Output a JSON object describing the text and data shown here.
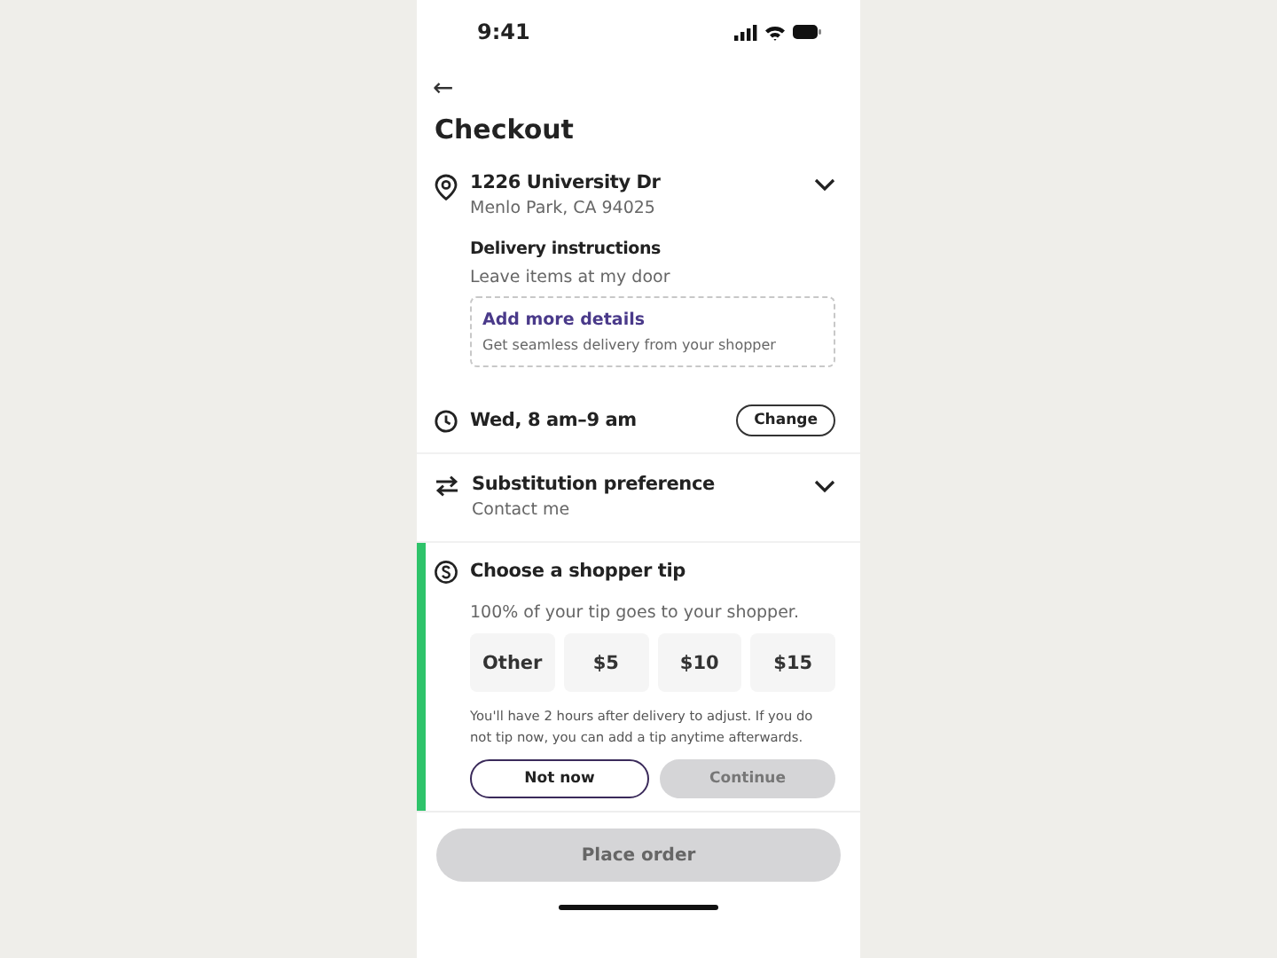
{
  "status_bar": {
    "time": "9:41"
  },
  "header": {
    "back": "←",
    "title": "Checkout"
  },
  "address": {
    "line1": "1226 University Dr",
    "line2": "Menlo Park, CA 94025",
    "expanded": false,
    "instructions_label": "Delivery instructions",
    "instructions": "Leave items at my door",
    "details_link": "Add more details",
    "details_hint": "Get seamless delivery from your shopper"
  },
  "delivery_time": {
    "label": "Wed, 8 am–9 am",
    "button": "Change"
  },
  "substitution": {
    "title": "Substitution preference",
    "value": "Contact me",
    "expanded": false
  },
  "tip": {
    "title": "Choose a shopper tip",
    "subtitle": "100% of your tip goes to your shopper.",
    "options": [
      {
        "label": "Other",
        "selected": false
      },
      {
        "label": "$5",
        "selected": false
      },
      {
        "label": "$10",
        "selected": false
      },
      {
        "label": "$15",
        "selected": false
      }
    ],
    "note": "You'll have 2 hours after delivery to adjust. If you do not tip now, you can add a tip anytime afterwards.",
    "buttons": [
      {
        "label": "Not now",
        "disabled": false,
        "kind": "outline"
      },
      {
        "label": "Continue",
        "disabled": true,
        "kind": "filled"
      }
    ]
  },
  "place_order": {
    "label": "Place order",
    "disabled": true
  }
}
